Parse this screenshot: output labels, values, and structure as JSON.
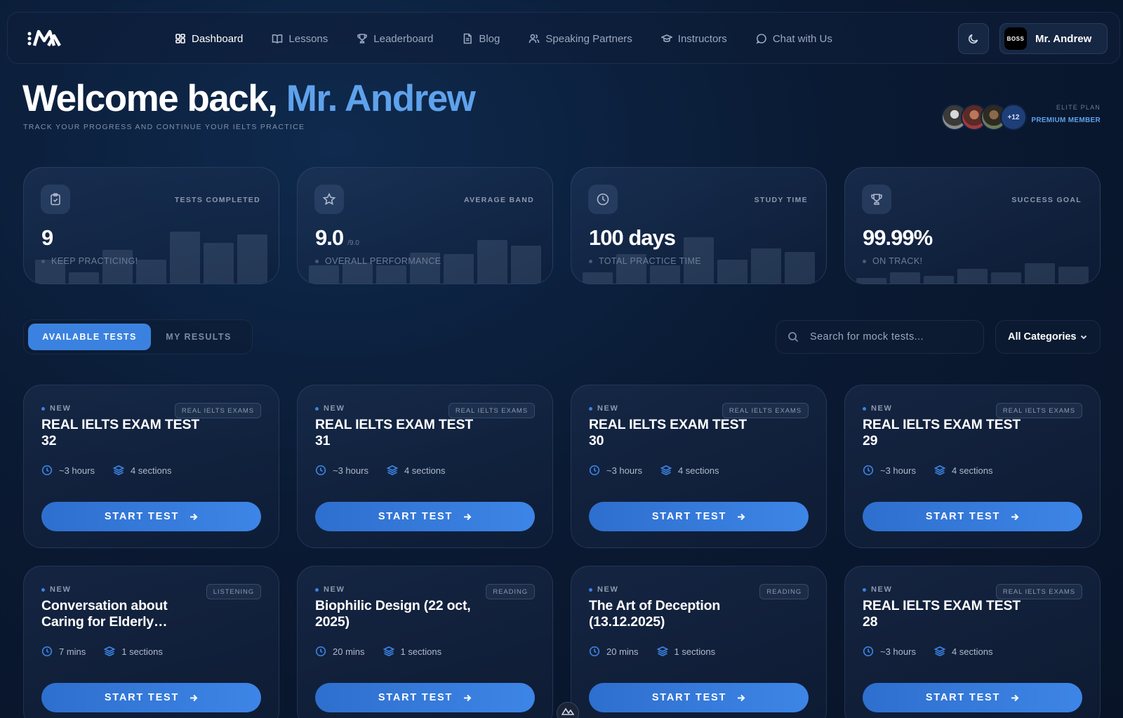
{
  "nav": {
    "logo_text": "iMA",
    "links": [
      {
        "label": "Dashboard",
        "icon": "dashboard-icon",
        "active": true
      },
      {
        "label": "Lessons",
        "icon": "book-icon",
        "active": false
      },
      {
        "label": "Leaderboard",
        "icon": "trophy-icon",
        "active": false
      },
      {
        "label": "Blog",
        "icon": "document-icon",
        "active": false
      },
      {
        "label": "Speaking Partners",
        "icon": "users-icon",
        "active": false
      },
      {
        "label": "Instructors",
        "icon": "graduation-cap-icon",
        "active": false
      },
      {
        "label": "Chat with Us",
        "icon": "chat-icon",
        "active": false
      }
    ],
    "theme_icon": "moon-icon",
    "user": {
      "badge": "BOSS",
      "name": "Mr. Andrew"
    }
  },
  "hero": {
    "greeting": "Welcome back,",
    "name": "Mr. Andrew",
    "subtitle": "TRACK YOUR PROGRESS AND CONTINUE YOUR IELTS PRACTICE",
    "extra_members": "+12",
    "plan_label": "ELITE PLAN",
    "plan_tier": "PREMIUM MEMBER"
  },
  "stats": [
    {
      "label": "TESTS COMPLETED",
      "value": "9",
      "max": "",
      "note": "KEEP PRACTICING!",
      "icon": "clipboard-icon",
      "bars": [
        0.42,
        0.2,
        0.6,
        0.42,
        0.92,
        0.72,
        0.88
      ]
    },
    {
      "label": "AVERAGE BAND",
      "value": "9.0",
      "max": "/9.0",
      "note": "OVERALL PERFORMANCE",
      "icon": "star-icon",
      "bars": [
        0.32,
        0.38,
        0.32,
        0.55,
        0.52,
        0.78,
        0.68
      ]
    },
    {
      "label": "STUDY TIME",
      "value": "100 days",
      "max": "",
      "note": "TOTAL PRACTICE TIME",
      "icon": "clock-icon",
      "bars": [
        0.2,
        0.52,
        0.32,
        0.82,
        0.42,
        0.62,
        0.56
      ]
    },
    {
      "label": "SUCCESS GOAL",
      "value": "99.99%",
      "max": "",
      "note": "ON TRACK!",
      "icon": "trophy-icon",
      "bars": [
        0.1,
        0.2,
        0.14,
        0.26,
        0.2,
        0.36,
        0.3
      ]
    }
  ],
  "tabs": {
    "available": "AVAILABLE TESTS",
    "results": "MY RESULTS"
  },
  "search": {
    "placeholder": "Search for mock tests..."
  },
  "category": {
    "selected": "All Categories"
  },
  "tests": [
    {
      "tag": "NEW",
      "badge": "REAL IELTS EXAMS",
      "title": "REAL IELTS EXAM TEST 32",
      "duration": "~3 hours",
      "sections": "4 sections",
      "button": "START TEST"
    },
    {
      "tag": "NEW",
      "badge": "REAL IELTS EXAMS",
      "title": "REAL IELTS EXAM TEST 31",
      "duration": "~3 hours",
      "sections": "4 sections",
      "button": "START TEST"
    },
    {
      "tag": "NEW",
      "badge": "REAL IELTS EXAMS",
      "title": "REAL IELTS EXAM TEST 30",
      "duration": "~3 hours",
      "sections": "4 sections",
      "button": "START TEST"
    },
    {
      "tag": "NEW",
      "badge": "REAL IELTS EXAMS",
      "title": "REAL IELTS EXAM TEST 29",
      "duration": "~3 hours",
      "sections": "4 sections",
      "button": "START TEST"
    },
    {
      "tag": "NEW",
      "badge": "LISTENING",
      "title": "Conversation about Caring for Elderly Mother...",
      "duration": "7 mins",
      "sections": "1 sections",
      "button": "START TEST"
    },
    {
      "tag": "NEW",
      "badge": "READING",
      "title": "Biophilic Design (22 oct, 2025)",
      "duration": "20 mins",
      "sections": "1 sections",
      "button": "START TEST"
    },
    {
      "tag": "NEW",
      "badge": "READING",
      "title": "The Art of Deception (13.12.2025)",
      "duration": "20 mins",
      "sections": "1 sections",
      "button": "START TEST"
    },
    {
      "tag": "NEW",
      "badge": "REAL IELTS EXAMS",
      "title": "REAL IELTS EXAM TEST 28",
      "duration": "~3 hours",
      "sections": "4 sections",
      "button": "START TEST"
    }
  ],
  "colors": {
    "accent": "#3b82e0",
    "name_highlight": "#5fa2ec",
    "background": "#0a1a33"
  }
}
